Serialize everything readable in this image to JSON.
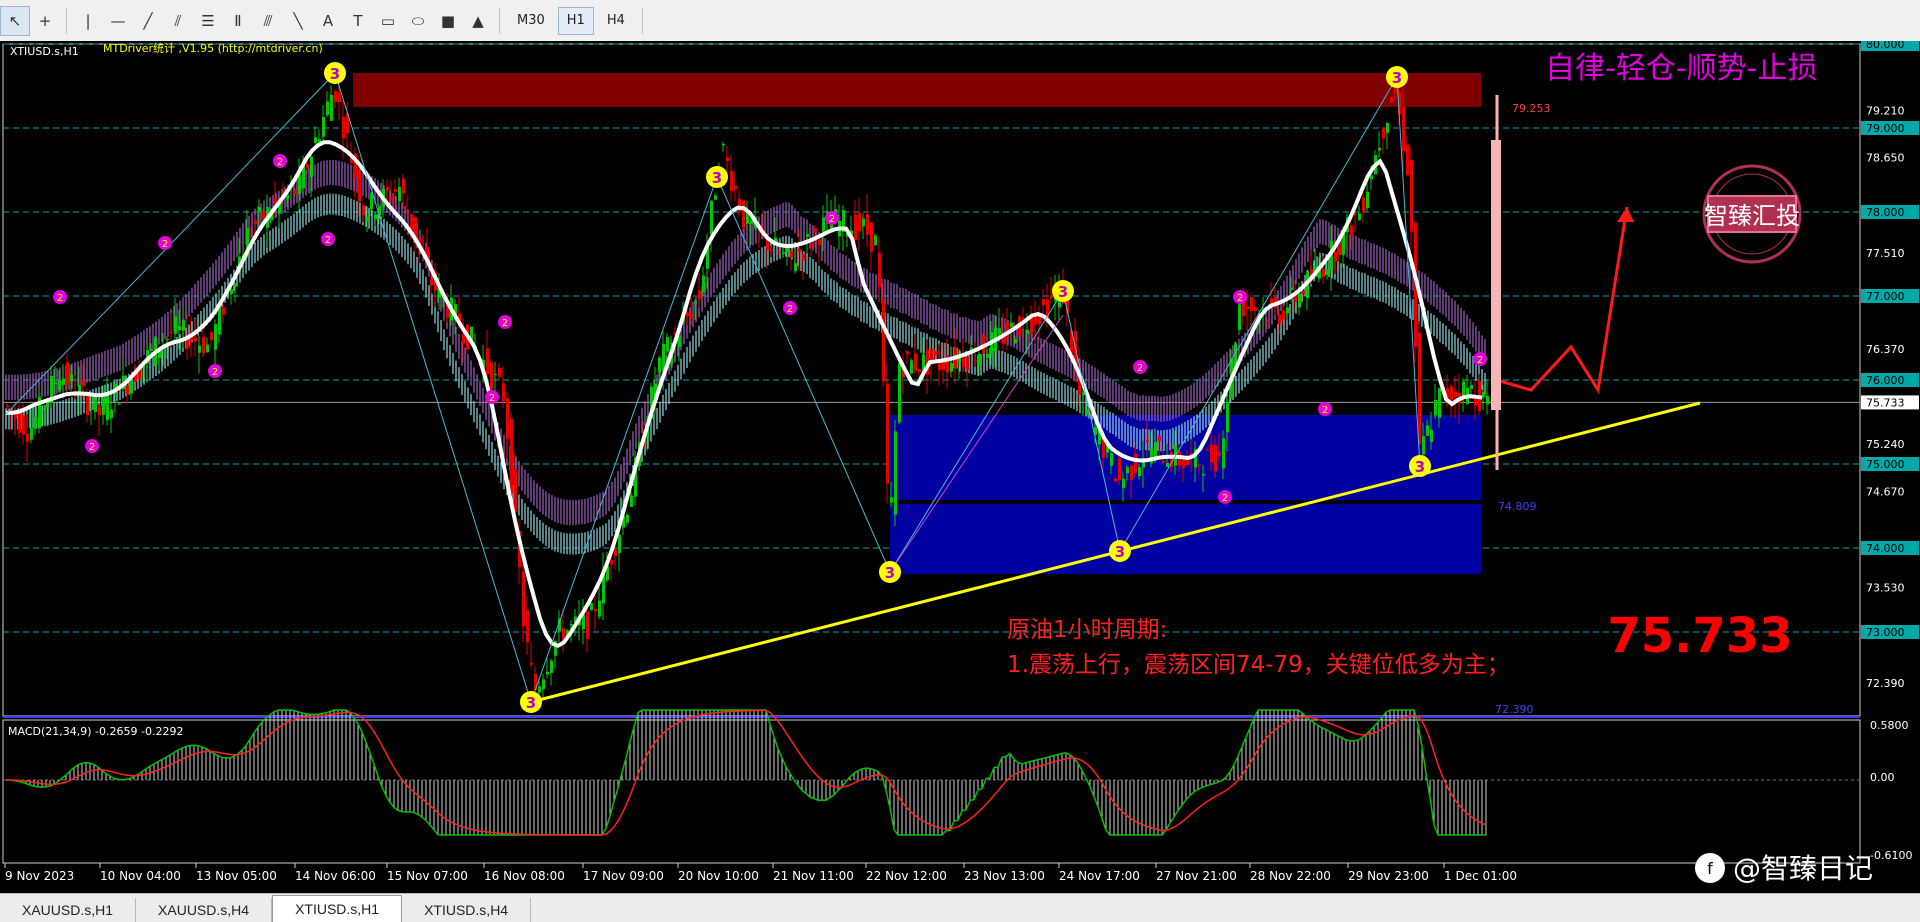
{
  "toolbar": {
    "timeframes": [
      "M30",
      "H1",
      "H4"
    ],
    "active_timeframe": "H1"
  },
  "chart": {
    "symbol_label": "XTIUSD.s,H1",
    "indicator_header": "MTDriver统计 ,V1.95 (http://mtdriver.cn)",
    "slogan": "自律-轻仓-顺势-止损",
    "watermark": "智臻汇投",
    "current_price_big": "75.733",
    "annotation_title": "原油1小时周期:",
    "annotation_text": "1.震荡上行，震荡区间74-79，关键位低多为主；",
    "price_levels": [
      "80.000",
      "79.210",
      "79.000",
      "78.650",
      "78.000",
      "77.510",
      "77.000",
      "76.370",
      "76.000",
      "75.733",
      "75.240",
      "75.000",
      "74.670",
      "74.000",
      "73.530",
      "73.000",
      "72.390"
    ],
    "box_label_upper": "79.253",
    "box_label_lower": "74.809",
    "bottom_label": "72.390",
    "macd_label": "MACD(21,34,9) -0.2659 -0.2292",
    "macd_levels": [
      "0.5800",
      "0.00",
      "-0.6100"
    ],
    "time_labels": [
      "9 Nov 2023",
      "10 Nov 04:00",
      "13 Nov 05:00",
      "14 Nov 06:00",
      "15 Nov 07:00",
      "16 Nov 08:00",
      "17 Nov 09:00",
      "20 Nov 10:00",
      "21 Nov 11:00",
      "22 Nov 12:00",
      "23 Nov 13:00",
      "24 Nov 17:00",
      "27 Nov 21:00",
      "28 Nov 22:00",
      "29 Nov 23:00",
      "1 Dec 01:00"
    ],
    "brand": "@智臻日记",
    "colors": {
      "bull": "#00c800",
      "bear": "#e60000",
      "ma": "#ffffff",
      "support": "#ffff00",
      "supply_zone": "#800000",
      "demand_zone": "#0000a0",
      "slogan": "#e000e0",
      "annotation": "#ff2020"
    }
  },
  "tabs": [
    "XAUUSD.s,H1",
    "XAUUSD.s,H4",
    "XTIUSD.s,H1",
    "XTIUSD.s,H4"
  ],
  "active_tab": "XTIUSD.s,H1"
}
